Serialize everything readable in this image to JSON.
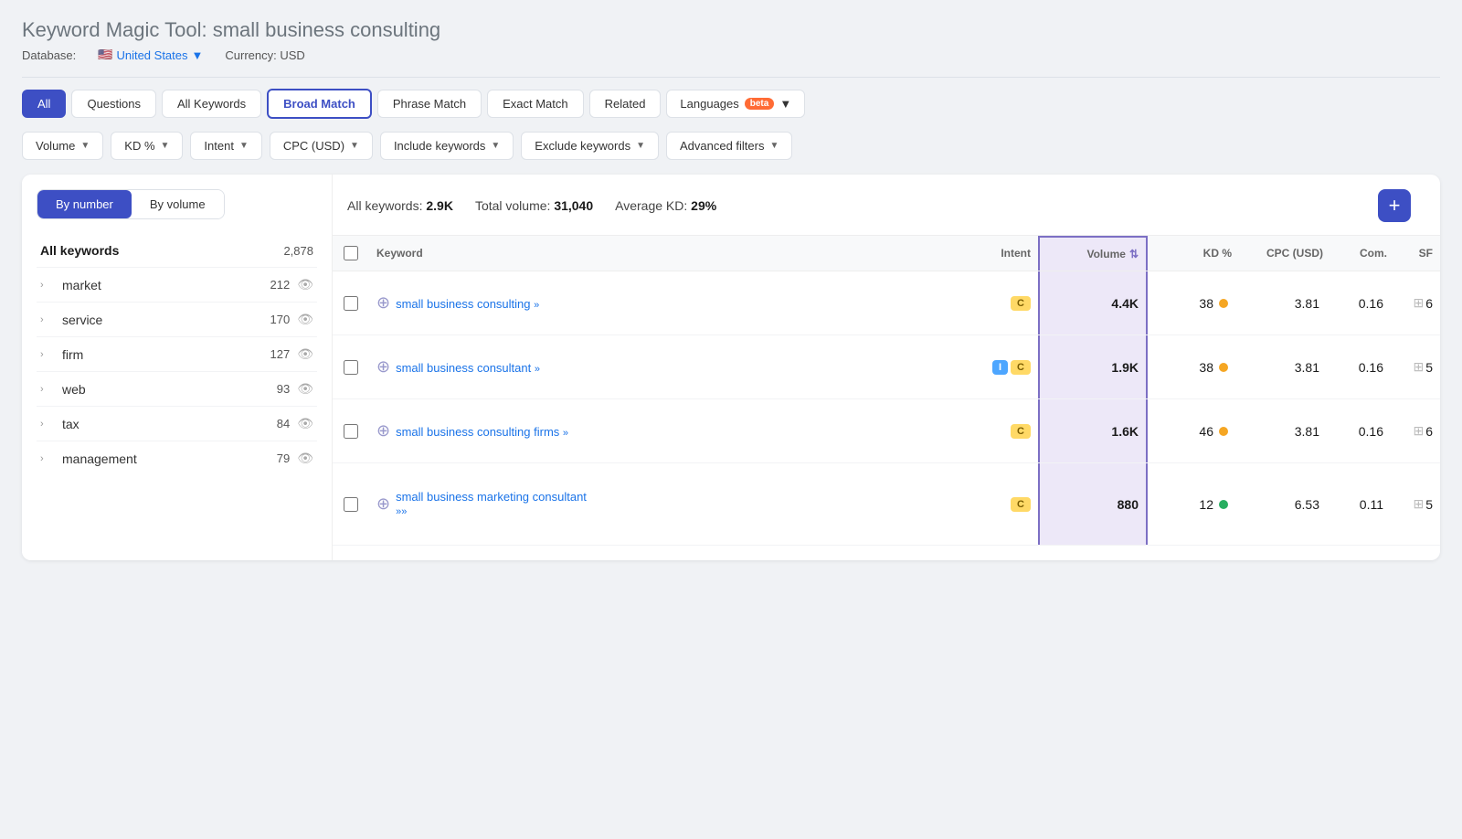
{
  "page": {
    "title": "Keyword Magic Tool:",
    "query": "small business consulting"
  },
  "meta": {
    "database_label": "Database:",
    "database_country": "United States",
    "currency_label": "Currency: USD"
  },
  "tabs": [
    {
      "id": "all",
      "label": "All",
      "active": true,
      "style": "all-active"
    },
    {
      "id": "questions",
      "label": "Questions",
      "active": false
    },
    {
      "id": "all-keywords",
      "label": "All Keywords",
      "active": false
    },
    {
      "id": "broad-match",
      "label": "Broad Match",
      "active": true,
      "style": "active"
    },
    {
      "id": "phrase-match",
      "label": "Phrase Match",
      "active": false
    },
    {
      "id": "exact-match",
      "label": "Exact Match",
      "active": false
    },
    {
      "id": "related",
      "label": "Related",
      "active": false
    }
  ],
  "languages_label": "Languages",
  "beta_label": "beta",
  "filters": [
    {
      "id": "volume",
      "label": "Volume"
    },
    {
      "id": "kd",
      "label": "KD %"
    },
    {
      "id": "intent",
      "label": "Intent"
    },
    {
      "id": "cpc",
      "label": "CPC (USD)"
    },
    {
      "id": "include",
      "label": "Include keywords"
    },
    {
      "id": "exclude",
      "label": "Exclude keywords"
    },
    {
      "id": "advanced",
      "label": "Advanced filters"
    }
  ],
  "view_toggle": {
    "by_number": "By number",
    "by_volume": "By volume"
  },
  "sidebar": {
    "all_label": "All keywords",
    "all_count": "2,878",
    "items": [
      {
        "label": "market",
        "count": "212"
      },
      {
        "label": "service",
        "count": "170"
      },
      {
        "label": "firm",
        "count": "127"
      },
      {
        "label": "web",
        "count": "93"
      },
      {
        "label": "tax",
        "count": "84"
      },
      {
        "label": "management",
        "count": "79"
      }
    ]
  },
  "summary": {
    "all_keywords_label": "All keywords:",
    "all_keywords_value": "2.9K",
    "total_volume_label": "Total volume:",
    "total_volume_value": "31,040",
    "avg_kd_label": "Average KD:",
    "avg_kd_value": "29%"
  },
  "table": {
    "columns": [
      "",
      "Keyword",
      "Intent",
      "Volume",
      "KD %",
      "CPC (USD)",
      "Com.",
      "SF"
    ],
    "rows": [
      {
        "keyword": "small business consulting",
        "keyword_arrows": "»",
        "intent": [
          "C"
        ],
        "volume": "4.4K",
        "kd": "38",
        "kd_color": "yellow",
        "cpc": "3.81",
        "com": "0.16",
        "sf": "6"
      },
      {
        "keyword": "small business consultant",
        "keyword_arrows": "»",
        "intent": [
          "I",
          "C"
        ],
        "volume": "1.9K",
        "kd": "38",
        "kd_color": "yellow",
        "cpc": "3.81",
        "com": "0.16",
        "sf": "5"
      },
      {
        "keyword": "small business consulting firms",
        "keyword_arrows": "»",
        "intent": [
          "C"
        ],
        "volume": "1.6K",
        "kd": "46",
        "kd_color": "yellow",
        "cpc": "3.81",
        "com": "0.16",
        "sf": "6"
      },
      {
        "keyword": "small business marketing consultant",
        "keyword_arrows": "»»",
        "intent": [
          "C"
        ],
        "volume": "880",
        "kd": "12",
        "kd_color": "green",
        "cpc": "6.53",
        "com": "0.11",
        "sf": "5"
      }
    ]
  }
}
